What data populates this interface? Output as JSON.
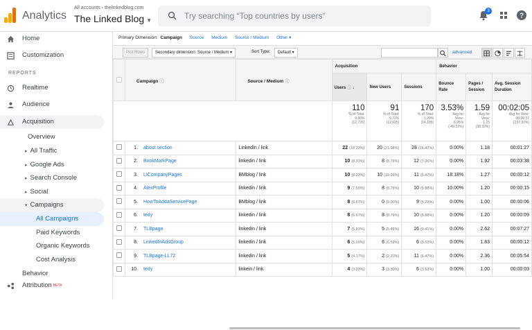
{
  "header": {
    "app_title": "Analytics",
    "account_crumb": "All accounts › thelinkedblog.com",
    "account_name": "The Linked Blog",
    "search_placeholder": "Try searching “Top countries by users”",
    "notification_count": "3",
    "brand_colors": {
      "logo_orange": "#f9ab00",
      "logo_dark": "#e37400",
      "accent": "#1a73e8"
    }
  },
  "sidebar": {
    "home": "Home",
    "customization": "Customization",
    "reports_label": "REPORTS",
    "realtime": "Realtime",
    "audience": "Audience",
    "acquisition": "Acquisition",
    "overview": "Overview",
    "all_traffic": "All Traffic",
    "google_ads": "Google Ads",
    "search_console": "Search Console",
    "social": "Social",
    "campaigns": "Campaigns",
    "all_campaigns": "All Campaigns",
    "paid_keywords": "Paid Keywords",
    "organic_keywords": "Organic Keywords",
    "cost_analysis": "Cost Analysis",
    "behavior": "Behavior",
    "attribution": "Attribution",
    "beta": "BETA"
  },
  "dimension_bar": {
    "label": "Primary Dimension:",
    "current": "Campaign",
    "links": [
      "Source",
      "Medium",
      "Source / Medium",
      "Other ▾"
    ]
  },
  "toolbar": {
    "plot_rows": "Plot Rows",
    "secondary_dimension": "Secondary dimension: Source / Medium ▾",
    "sort_type_label": "Sort Type:",
    "sort_type_value": "Default ▾",
    "advanced": "advanced"
  },
  "table": {
    "group_acquisition": "Acquisition",
    "group_behavior": "Behavior",
    "col_campaign": "Campaign",
    "col_source_medium": "Source / Medium",
    "col_users": "Users",
    "col_new_users": "New Users",
    "col_sessions": "Sessions",
    "col_bounce_rate": "Bounce Rate",
    "col_pages_session": "Pages / Session",
    "col_avg_session": "Avg. Session Duration",
    "totals": {
      "users": {
        "value": "110",
        "l1": "% of Total:",
        "l2": "0.86%",
        "l3": "(12,726)"
      },
      "new_users": {
        "value": "91",
        "l1": "% of Total:",
        "l2": "0.72%",
        "l3": "(12,625)"
      },
      "sessions": {
        "value": "170",
        "l1": "% of Total:",
        "l2": "1.20%",
        "l3": "(14,185)"
      },
      "bounce_rate": {
        "value": "3.53%",
        "l1": "Avg for",
        "l2": "View:",
        "l3": "6.95%",
        "l4": "(-49.22%)"
      },
      "pages_session": {
        "value": "1.59",
        "l1": "Avg for",
        "l2": "View:",
        "l3": "1.15",
        "l4": "(38.32%)"
      },
      "avg_session": {
        "value": "00:02:05",
        "l1": "Avg for View:",
        "l2": "00:00:37",
        "l3": "(237.37%)"
      }
    },
    "rows": [
      {
        "idx": "1.",
        "campaign": "about section",
        "source": "LinkedIn / link",
        "users": "22",
        "users_pct": "(18.33%)",
        "new_users": "20",
        "new_users_pct": "(21.98%)",
        "sessions": "28",
        "sessions_pct": "(16.47%)",
        "bounce": "0.00%",
        "pages": "1.18",
        "duration": "00:01:27"
      },
      {
        "idx": "2.",
        "campaign": "BookMarkPage",
        "source": "linkedin / link",
        "users": "10",
        "users_pct": "(8.33%)",
        "new_users": "8",
        "new_users_pct": "(8.79%)",
        "sessions": "12",
        "sessions_pct": "(7.06%)",
        "bounce": "0.00%",
        "pages": "1.92",
        "duration": "00:03:38"
      },
      {
        "idx": "3.",
        "campaign": "LICompanyPages",
        "source": "BMblog / link",
        "users": "10",
        "users_pct": "(8.33%)",
        "new_users": "10",
        "new_users_pct": "(10.99%)",
        "sessions": "11",
        "sessions_pct": "(6.47%)",
        "bounce": "18.18%",
        "pages": "1.27",
        "duration": "00:00:12"
      },
      {
        "idx": "4.",
        "campaign": "AlexProfile",
        "source": "linkedin / link",
        "users": "9",
        "users_pct": "(7.50%)",
        "new_users": "8",
        "new_users_pct": "(8.79%)",
        "sessions": "10",
        "sessions_pct": "(5.88%)",
        "bounce": "10.00%",
        "pages": "1.20",
        "duration": "00:00:15"
      },
      {
        "idx": "5.",
        "campaign": "HowToAddaServicePage",
        "source": "BMblog / link",
        "users": "8",
        "users_pct": "(6.67%)",
        "new_users": "0",
        "new_users_pct": "(0.00%)",
        "sessions": "9",
        "sessions_pct": "(5.29%)",
        "bounce": "0.00%",
        "pages": "1.00",
        "duration": "00:00:06"
      },
      {
        "idx": "6.",
        "campaign": "tedy",
        "source": "linkedin / link",
        "users": "8",
        "users_pct": "(6.67%)",
        "new_users": "8",
        "new_users_pct": "(8.79%)",
        "sessions": "10",
        "sessions_pct": "(5.88%)",
        "bounce": "0.00%",
        "pages": "1.20",
        "duration": "00:00:09"
      },
      {
        "idx": "7.",
        "campaign": "TLBpage",
        "source": "linkedin / link",
        "users": "7",
        "users_pct": "(5.83%)",
        "new_users": "5",
        "new_users_pct": "(5.49%)",
        "sessions": "16",
        "sessions_pct": "(9.41%)",
        "bounce": "0.00%",
        "pages": "2.62",
        "duration": "00:07:27"
      },
      {
        "idx": "8.",
        "campaign": "LinkedInAdsGroup",
        "source": "linkedin / link",
        "users": "6",
        "users_pct": "(5.00%)",
        "new_users": "6",
        "new_users_pct": "(6.59%)",
        "sessions": "6",
        "sessions_pct": "(3.53%)",
        "bounce": "0.00%",
        "pages": "1.83",
        "duration": "00:00:12"
      },
      {
        "idx": "9.",
        "campaign": "TLBpage-LL72",
        "source": "linkedin / link",
        "users": "5",
        "users_pct": "(4.17%)",
        "new_users": "2",
        "new_users_pct": "(2.20%)",
        "sessions": "11",
        "sessions_pct": "(6.47%)",
        "bounce": "0.00%",
        "pages": "2.36",
        "duration": "00:05:54"
      },
      {
        "idx": "10.",
        "campaign": "tedy",
        "source": "linkein / link",
        "users": "4",
        "users_pct": "(3.33%)",
        "new_users": "3",
        "new_users_pct": "(3.30%)",
        "sessions": "6",
        "sessions_pct": "(3.53%)",
        "bounce": "0.00%",
        "pages": "1.00",
        "duration": "00:00:03"
      }
    ]
  }
}
